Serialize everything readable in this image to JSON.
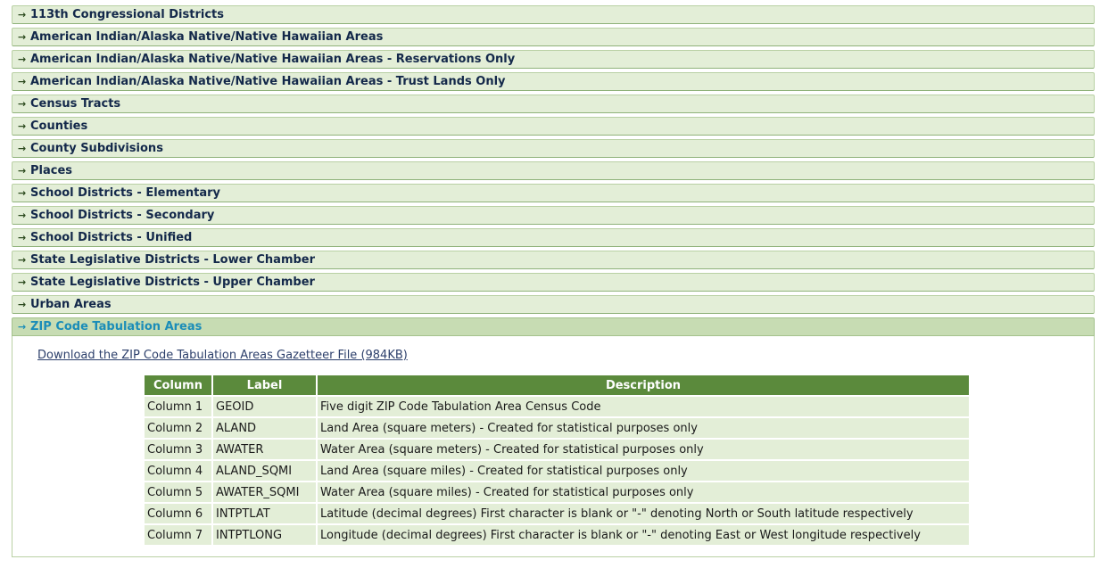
{
  "accordion": [
    {
      "label": "113th Congressional Districts"
    },
    {
      "label": "American Indian/Alaska Native/Native Hawaiian Areas"
    },
    {
      "label": "American Indian/Alaska Native/Native Hawaiian Areas - Reservations Only"
    },
    {
      "label": "American Indian/Alaska Native/Native Hawaiian Areas - Trust Lands Only"
    },
    {
      "label": "Census Tracts"
    },
    {
      "label": "Counties"
    },
    {
      "label": "County Subdivisions"
    },
    {
      "label": "Places"
    },
    {
      "label": "School Districts - Elementary"
    },
    {
      "label": "School Districts - Secondary"
    },
    {
      "label": "School Districts - Unified"
    },
    {
      "label": "State Legislative Districts - Lower Chamber"
    },
    {
      "label": "State Legislative Districts - Upper Chamber"
    },
    {
      "label": "Urban Areas"
    }
  ],
  "open_section": {
    "label": "ZIP Code Tabulation Areas",
    "download_link": "Download the ZIP Code Tabulation Areas Gazetteer File (984KB)",
    "table": {
      "headers": [
        "Column",
        "Label",
        "Description"
      ],
      "rows": [
        [
          "Column 1",
          "GEOID",
          "Five digit ZIP Code Tabulation Area Census Code"
        ],
        [
          "Column 2",
          "ALAND",
          "Land Area (square meters) - Created for statistical purposes only"
        ],
        [
          "Column 3",
          "AWATER",
          "Water Area (square meters) - Created for statistical purposes only"
        ],
        [
          "Column 4",
          "ALAND_SQMI",
          "Land Area (square miles) - Created for statistical purposes only"
        ],
        [
          "Column 5",
          "AWATER_SQMI",
          "Water Area (square miles) - Created for statistical purposes only"
        ],
        [
          "Column 6",
          "INTPTLAT",
          "Latitude (decimal degrees) First character is blank or \"-\" denoting North or South latitude respectively"
        ],
        [
          "Column 7",
          "INTPTLONG",
          "Longitude (decimal degrees) First character is blank or \"-\" denoting East or West longitude respectively"
        ]
      ]
    }
  },
  "icons": {
    "collapsed": "arrow-right-icon",
    "expanded": "arrow-down-icon"
  },
  "colors": {
    "header_green": "#5b8a3c",
    "row_bg": "#e3eed7",
    "open_title": "#1b8db8"
  }
}
